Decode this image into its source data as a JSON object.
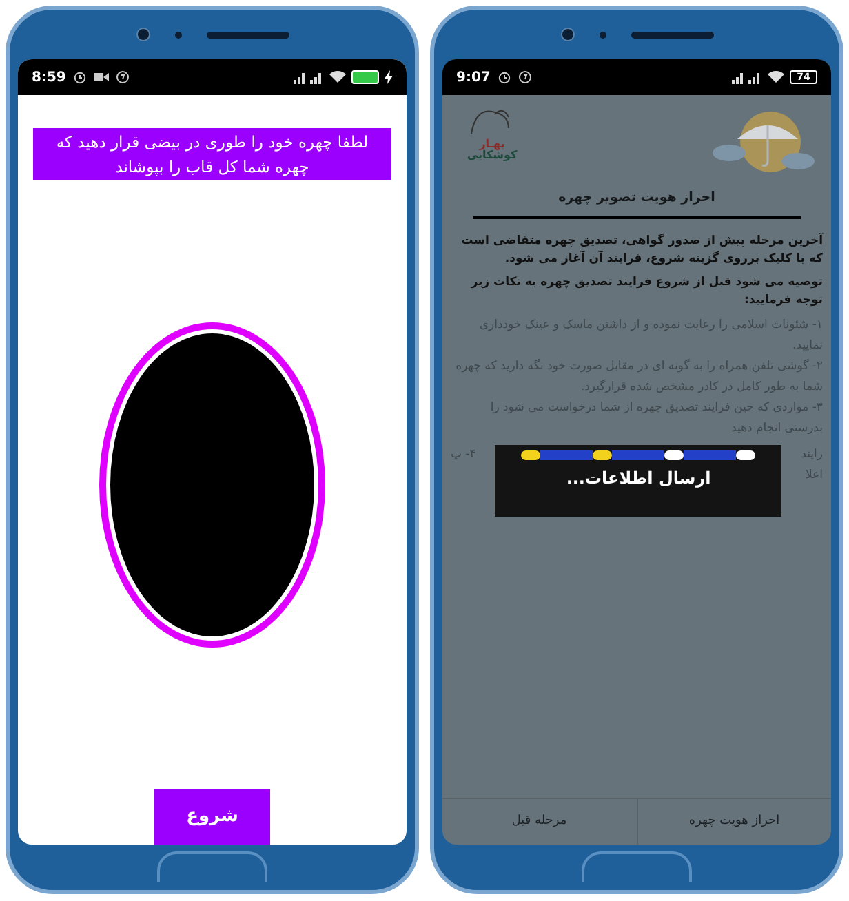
{
  "phones": [
    {
      "kind": "guide",
      "status_bar": {
        "time": "9:07",
        "battery": "74",
        "charging": false
      },
      "logo": {
        "line_1": "بهـار",
        "line_2": "کوشکایی"
      },
      "title": "احراز هویت تصویر چهره",
      "paragraphs": [
        "آخرین مرحله پیش از صدور گواهی، تصدیق چهره متقاضی است که با کلیک برروی گزینه شروع، فرایند آن آغاز می شود.",
        "توصیه می شود قبل از شروع فرایند تصدیق چهره به نکات زیر توجه فرمایید:"
      ],
      "items": [
        "۱- شئونات اسلامی را رعایت نموده و از داشتن ماسک و عینک خودداری نمایید.",
        "۲- گوشی تلفن همراه را به گونه ای در مقابل صورت خود نگه دارید که چهره شما به طور کامل در کادر مشخص شده قرارگیرد.",
        "۳- مواردی که حین فرایند تصدیق چهره از شما درخواست می شود را بدرستی انجام دهید"
      ],
      "hidden_item": {
        "right": "رایند",
        "left": "۴- پ",
        "right_2": "اعلا"
      },
      "dialog": {
        "message": "ارسال اطلاعات..."
      },
      "nav": [
        {
          "label": "احراز هویت چهره"
        },
        {
          "label": "مرحله قبل"
        }
      ]
    },
    {
      "kind": "capture",
      "status_bar": {
        "time": "8:59",
        "charging": true
      },
      "instruction": "لطفا چهره خود را طوری در بیضی قرار دهید که چهره شما کل قاب را بپوشاند",
      "start_button": "شروع"
    }
  ]
}
